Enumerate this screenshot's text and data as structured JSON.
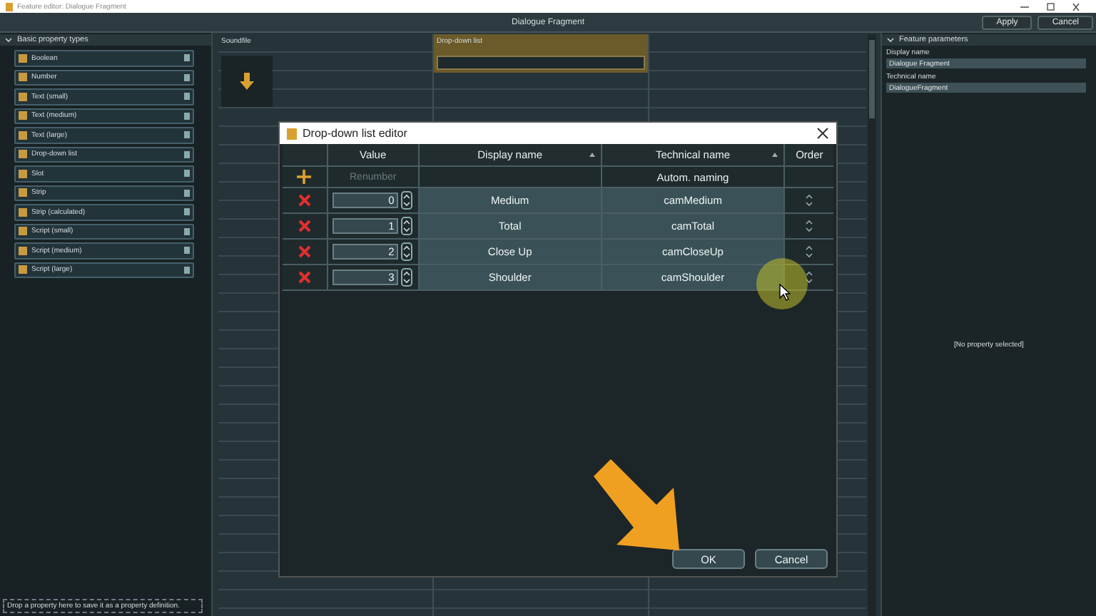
{
  "window": {
    "title": "Feature editor: Dialogue Fragment"
  },
  "toolbar": {
    "title": "Dialogue Fragment",
    "buttons": [
      "Apply",
      "Cancel"
    ]
  },
  "property_types": {
    "header": "Basic property types",
    "expanded": true,
    "items": [
      {
        "label": "Boolean"
      },
      {
        "label": "Number"
      },
      {
        "label": "Text (small)"
      },
      {
        "label": "Text (medium)"
      },
      {
        "label": "Text (large)"
      },
      {
        "label": "Drop-down list"
      },
      {
        "label": "Slot"
      },
      {
        "label": "Strip"
      },
      {
        "label": "Strip (calculated)"
      },
      {
        "label": "Script (small)"
      },
      {
        "label": "Script (medium)"
      },
      {
        "label": "Script (large)"
      }
    ]
  },
  "drop_hint": "Drop a property here to save it as a property definition.",
  "canvas": {
    "columns": [
      {
        "label": "Soundfile",
        "selected": false
      },
      {
        "label": "Drop-down list",
        "selected": true
      }
    ]
  },
  "feature_parameters": {
    "header": "Feature parameters",
    "expanded": true,
    "fields": [
      {
        "label": "Display name",
        "value": "Dialogue Fragment"
      },
      {
        "label": "Technical name",
        "value": "DialogueFragment"
      }
    ],
    "empty_note": "[No property selected]"
  },
  "dialog": {
    "title": "Drop-down list editor",
    "columns": [
      "Value",
      "Display name",
      "Technical name",
      "Order"
    ],
    "renumber": {
      "label": "Renumber",
      "disabled": true
    },
    "auto_naming": "Autom. naming",
    "rows": [
      {
        "value": "0",
        "display": "Medium",
        "technical": "camMedium"
      },
      {
        "value": "1",
        "display": "Total",
        "technical": "camTotal"
      },
      {
        "value": "2",
        "display": "Close Up",
        "technical": "camCloseUp"
      },
      {
        "value": "3",
        "display": "Shoulder",
        "technical": "camShoulder"
      }
    ],
    "buttons": [
      "OK",
      "Cancel"
    ]
  }
}
